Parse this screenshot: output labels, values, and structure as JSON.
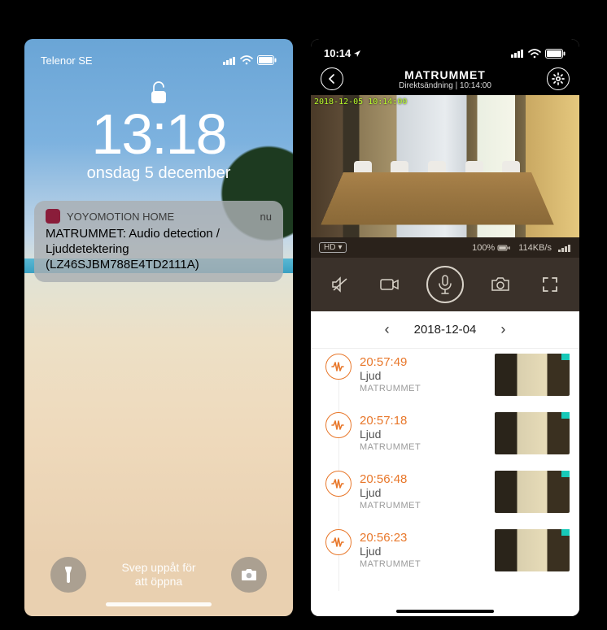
{
  "left": {
    "carrier": "Telenor SE",
    "time": "13:18",
    "date": "onsdag 5 december",
    "notification": {
      "app": "YOYOMOTION HOME",
      "when": "nu",
      "body": "MATRUMMET: Audio detection / Ljuddetektering (LZ46SJBM788E4TD2111A)"
    },
    "swipe_line1": "Svep uppåt för",
    "swipe_line2": "att öppna"
  },
  "right": {
    "status_time": "10:14",
    "room": "MATRUMMET",
    "subtitle": "Direktsändning | 10:14:00",
    "overlay_ts": "2018-12-05 10:14:00",
    "hd": "HD",
    "battery_pct": "100%",
    "bitrate": "114KB/s",
    "date": "2018-12-04",
    "events": [
      {
        "time": "20:57:49",
        "type": "Ljud",
        "room": "MATRUMMET"
      },
      {
        "time": "20:57:18",
        "type": "Ljud",
        "room": "MATRUMMET"
      },
      {
        "time": "20:56:48",
        "type": "Ljud",
        "room": "MATRUMMET"
      },
      {
        "time": "20:56:23",
        "type": "Ljud",
        "room": "MATRUMMET"
      }
    ]
  }
}
